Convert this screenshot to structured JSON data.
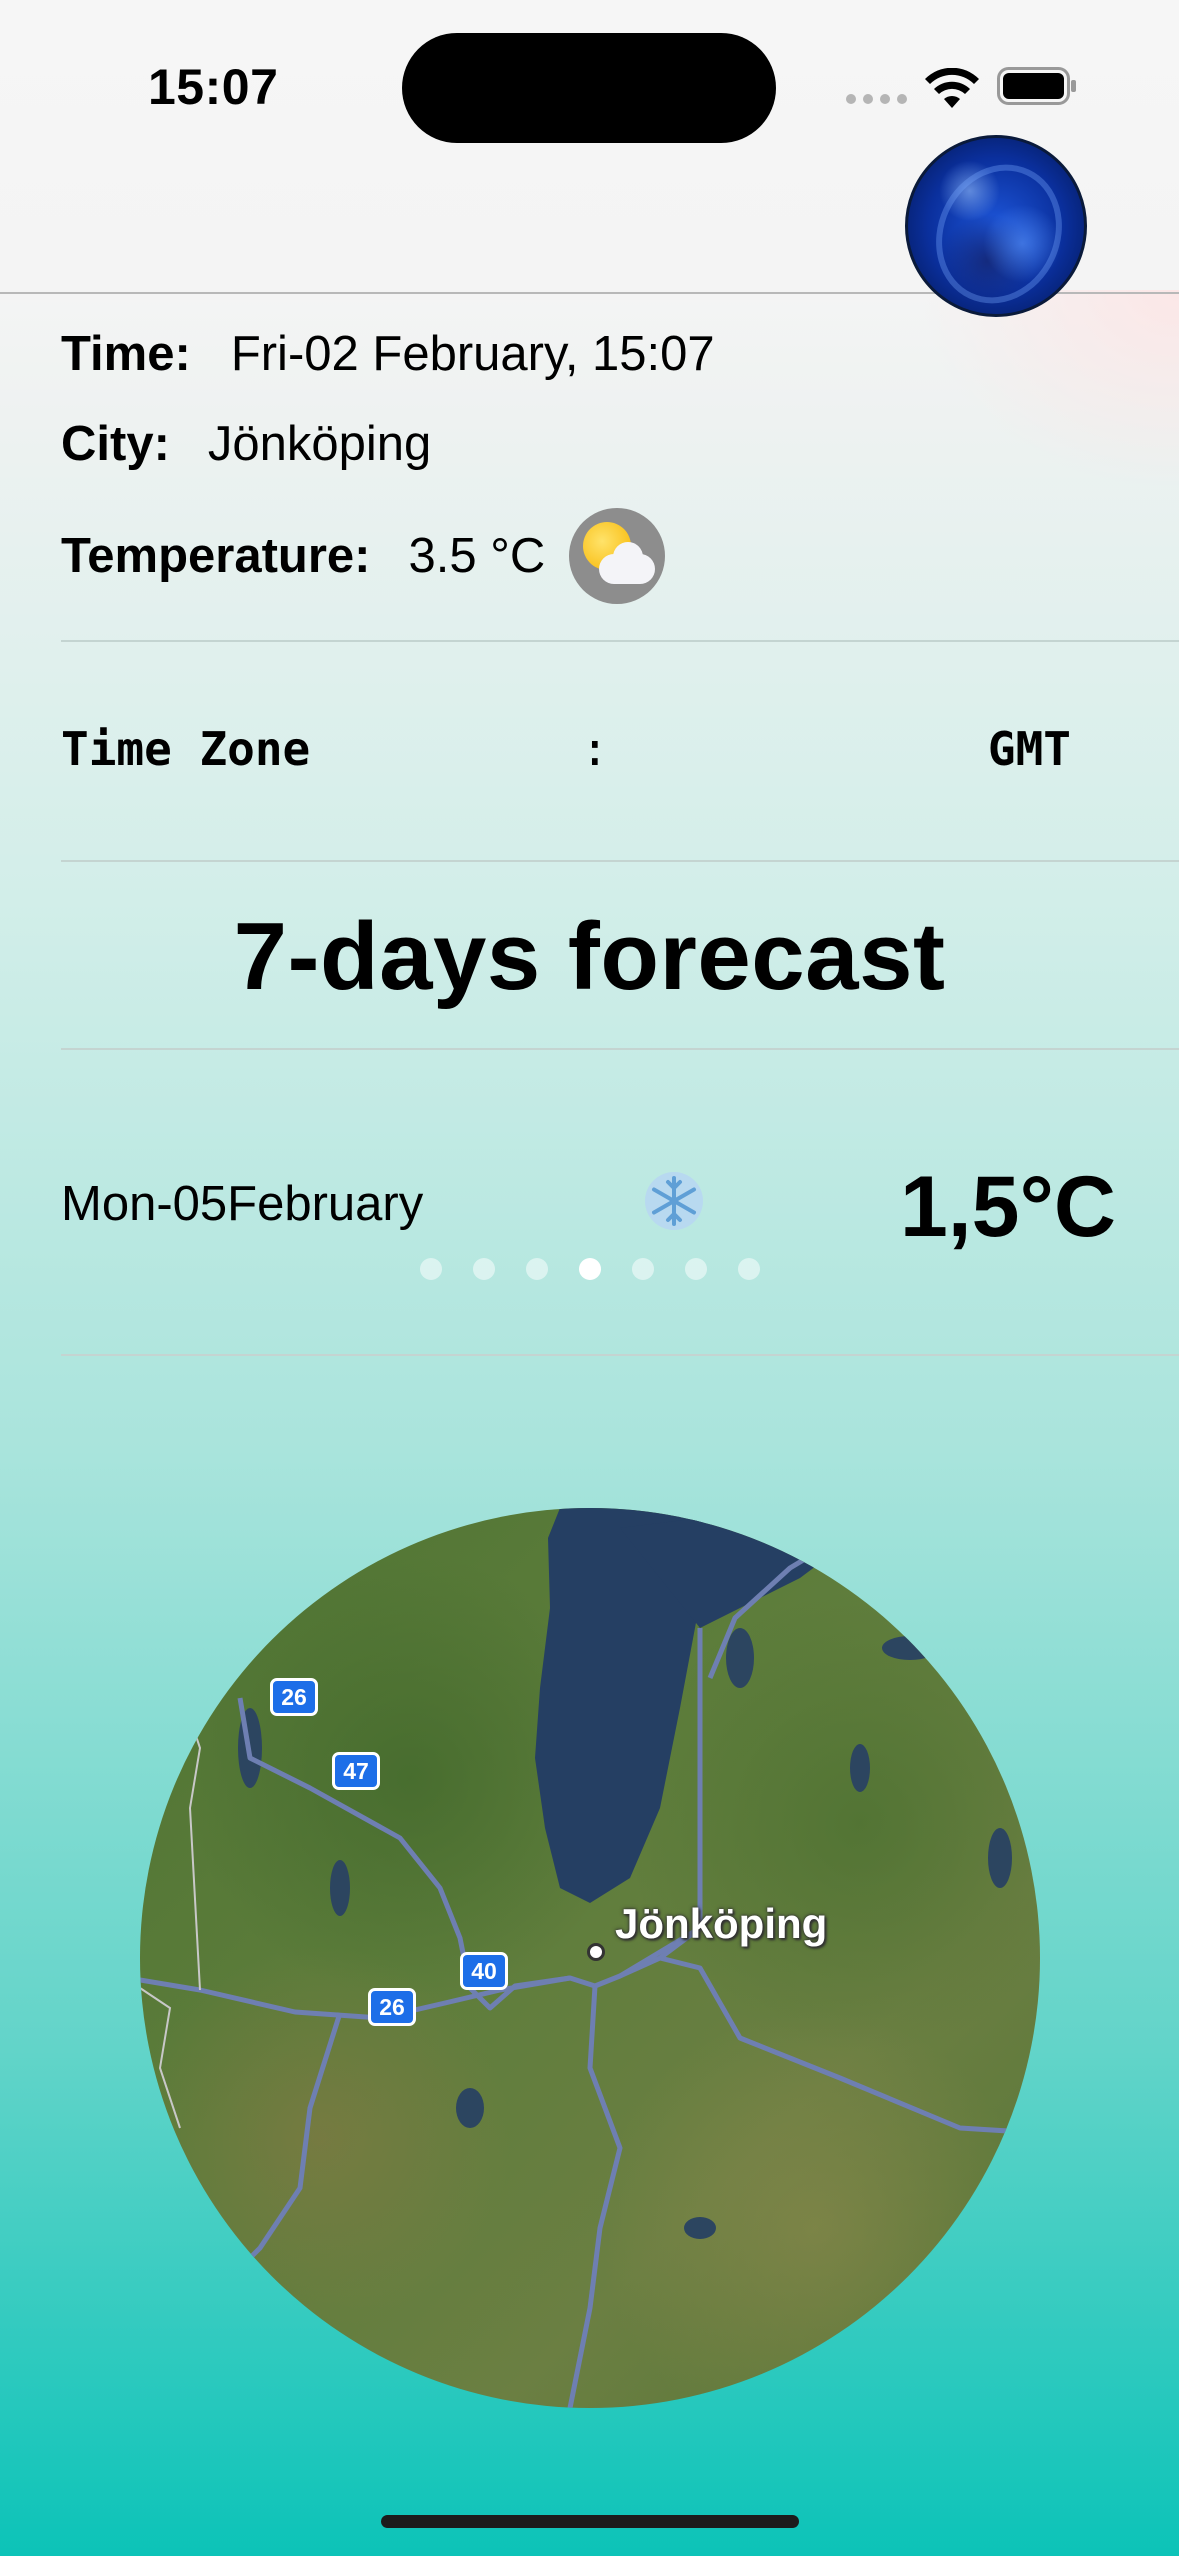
{
  "status_bar": {
    "time": "15:07"
  },
  "current": {
    "time_label": "Time:",
    "time_value": "Fri-02 February, 15:07",
    "city_label": "City:",
    "city_value": "Jönköping",
    "temperature_label": "Temperature:",
    "temperature_value": "3.5 °C",
    "weather_icon": "partly-cloudy-icon"
  },
  "timezone": {
    "label": "Time Zone",
    "separator": ":",
    "value": "GMT"
  },
  "forecast": {
    "title": "7-days forecast",
    "selected_day": "Mon-05February",
    "selected_icon": "snowflake-icon",
    "selected_temp": "1,5°C",
    "page_count": 7,
    "active_page": 4
  },
  "map": {
    "city_label": "Jönköping",
    "road_shields": [
      "26",
      "47",
      "40",
      "26"
    ]
  },
  "colors": {
    "background_top": "#f4f4f4",
    "background_bottom": "#0cc3b8",
    "shield_blue": "#1d6ee8"
  }
}
